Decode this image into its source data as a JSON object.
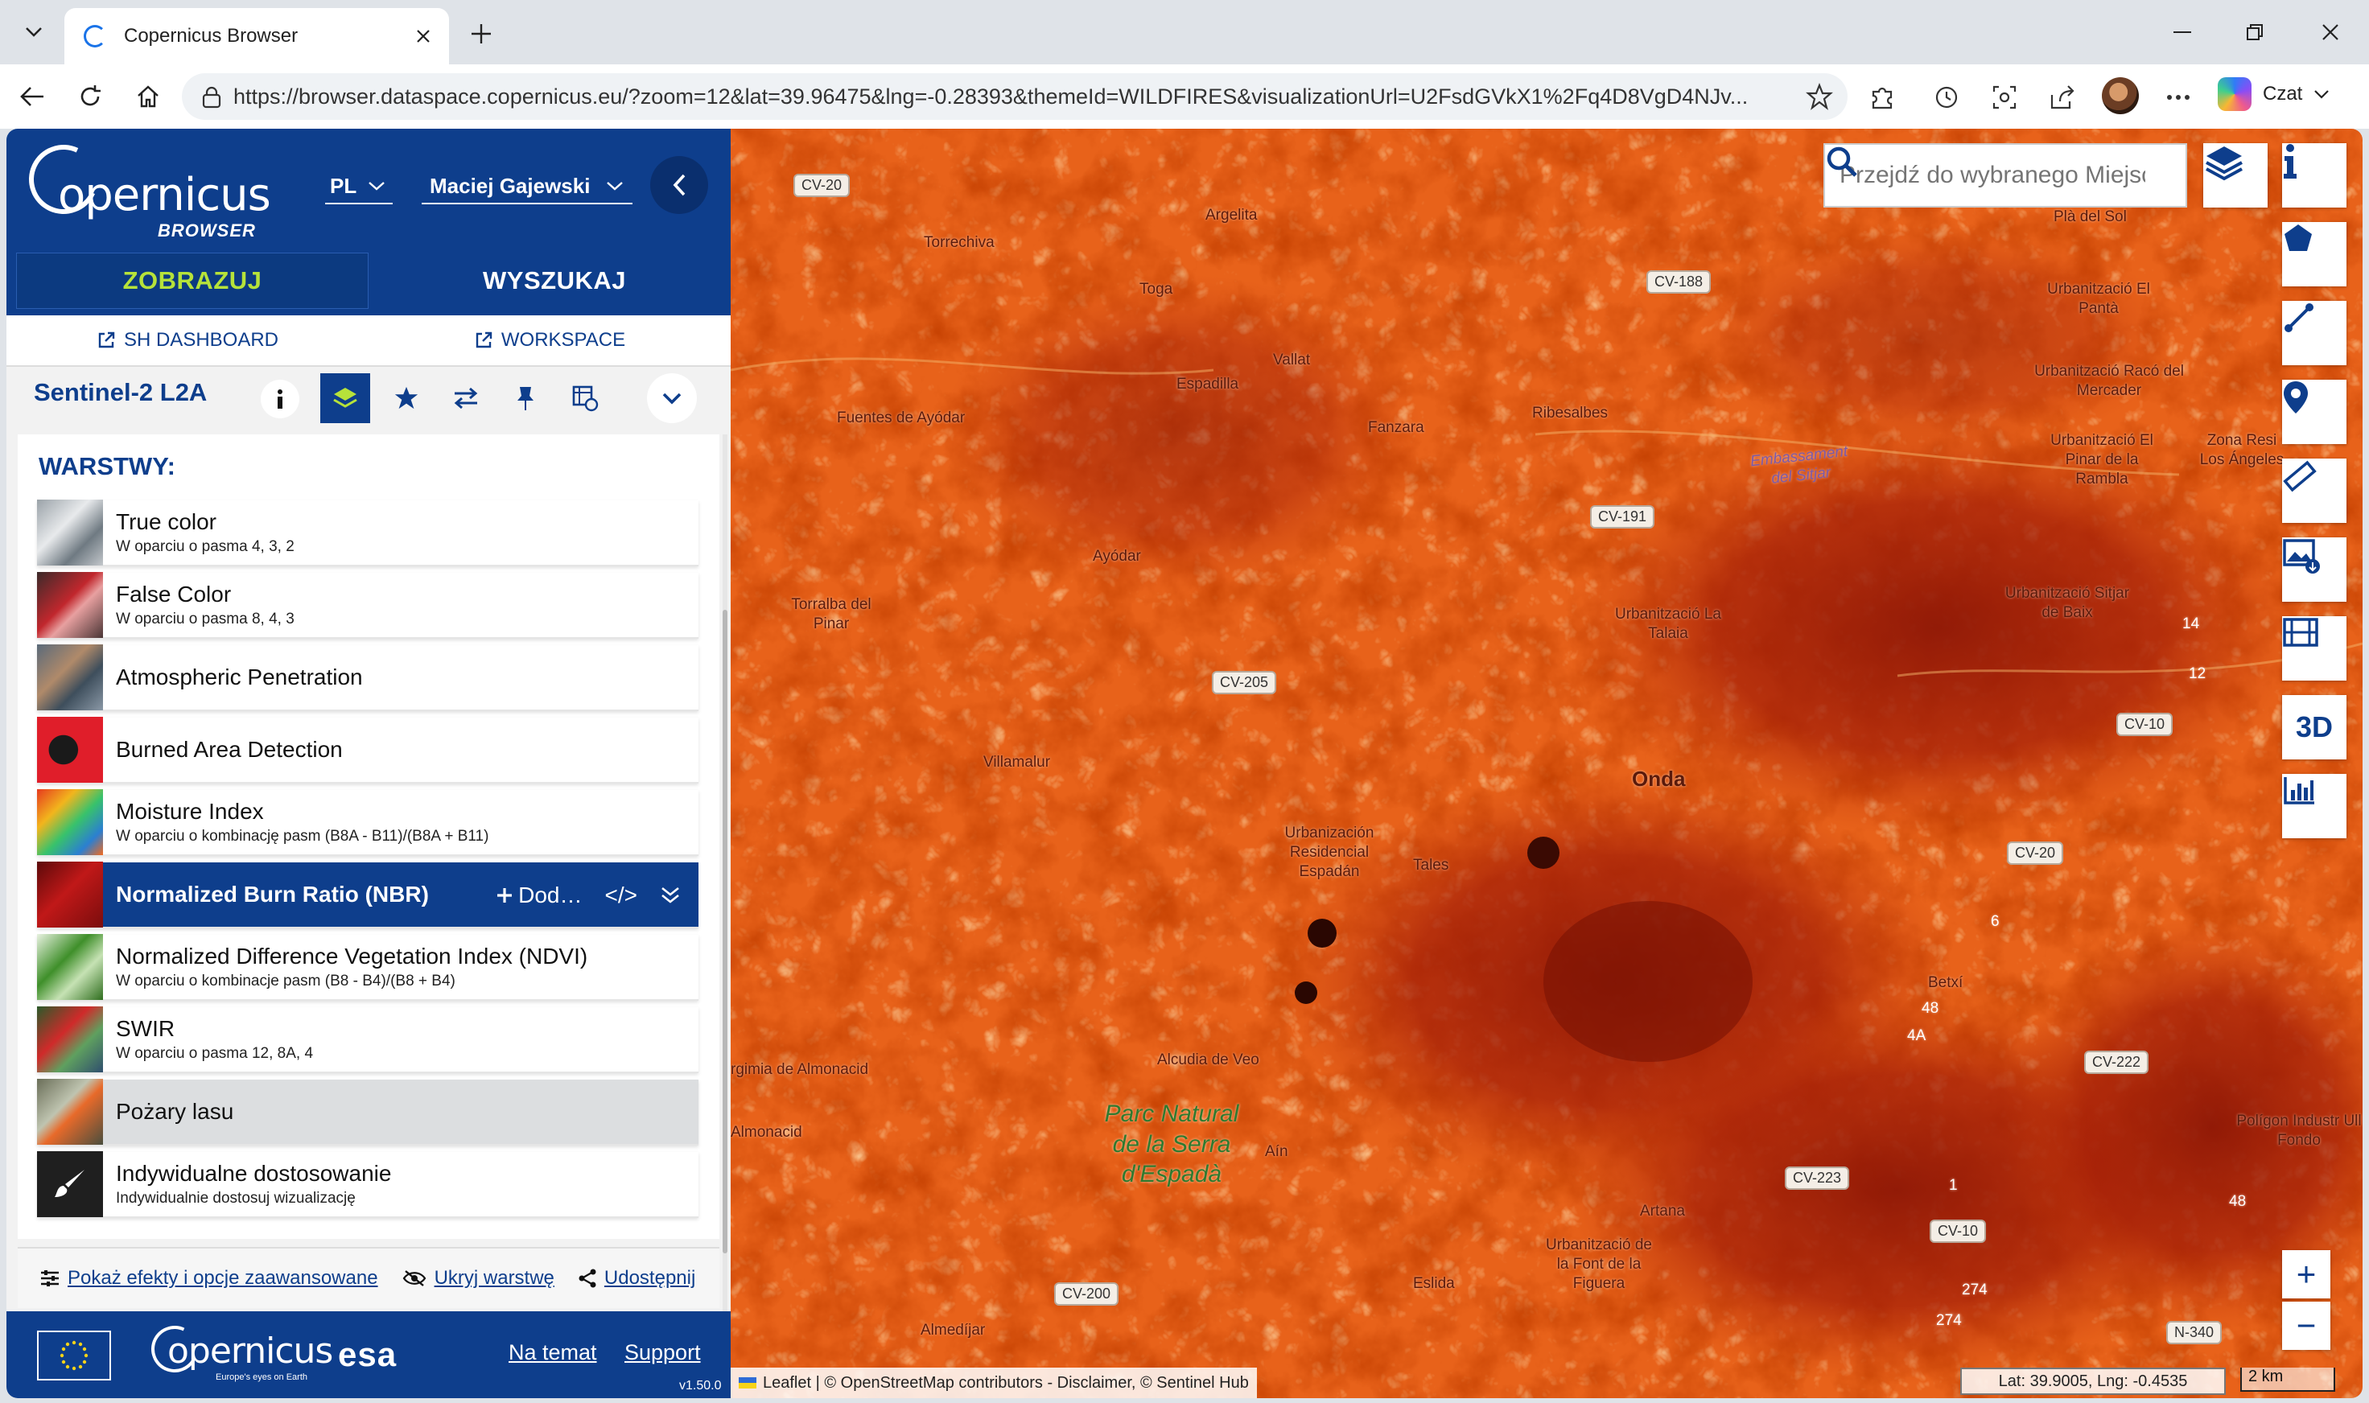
{
  "browser": {
    "tab_title": "Copernicus Browser",
    "url": "https://browser.dataspace.copernicus.eu/?zoom=12&lat=39.96475&lng=-0.28393&themeId=WILDFIRES&visualizationUrl=U2FsdGVkX1%2Fq4D8VgD4NJv...",
    "copilot_label": "Czat"
  },
  "panel": {
    "logo_word": "opernicus",
    "logo_sub": "BROWSER",
    "language": "PL",
    "user": "Maciej Gajewski",
    "tabs": [
      {
        "label": "ZOBRAZUJ",
        "active": true
      },
      {
        "label": "WYSZUKAJ",
        "active": false
      }
    ],
    "links": [
      "SH DASHBOARD",
      "WORKSPACE"
    ],
    "dataset": "Sentinel-2 L2A",
    "layers_title": "WARSTWY:",
    "layers": [
      {
        "name": "True color",
        "desc": "W oparciu o pasma 4, 3, 2"
      },
      {
        "name": "False Color",
        "desc": "W oparciu o pasma 8, 4, 3"
      },
      {
        "name": "Atmospheric Penetration",
        "desc": ""
      },
      {
        "name": "Burned Area Detection",
        "desc": ""
      },
      {
        "name": "Moisture Index",
        "desc": "W oparciu o kombinację pasm (B8A - B11)/(B8A + B11)"
      },
      {
        "name": "Normalized Burn Ratio (NBR)",
        "desc": ""
      },
      {
        "name": "Normalized Difference Vegetation Index (NDVI)",
        "desc": "W oparciu o kombinacje pasm (B8 - B4)/(B8 + B4)"
      },
      {
        "name": "SWIR",
        "desc": "W oparciu o pasma 12, 8A, 4"
      },
      {
        "name": "Pożary lasu",
        "desc": ""
      },
      {
        "name": "Indywidualne dostosowanie",
        "desc": "Indywidualnie dostosuj wizualizację"
      }
    ],
    "selected_actions": {
      "add": "Dod…",
      "code": "</>"
    },
    "bottom_links": [
      "Pokaż efekty i opcje zaawansowane",
      "Ukryj warstwę",
      "Udostępnij"
    ],
    "footer": {
      "logo_word": "opernicus",
      "logo_tag": "Europe's eyes on Earth",
      "esa": "esa",
      "about": "Na temat",
      "support": "Support",
      "version": "v1.50.0"
    }
  },
  "map": {
    "search_placeholder": "Przejdź do wybranego Miejsca",
    "attribution": "Leaflet | © OpenStreetMap contributors - Disclaimer, © Sentinel Hub",
    "coords": "Lat: 39.9005, Lng: -0.4535",
    "scale": "2 km",
    "zoom_in": "+",
    "zoom_out": "−",
    "label_3d": "3D",
    "places": [
      "Torrechiva",
      "Argelita",
      "Toga",
      "Vallat",
      "Espadilla",
      "Fuentes de Ayódar",
      "Fanzara",
      "Ribesalbes",
      "Embassament del Sitjar",
      "Ayódar",
      "Torralba del Pinar",
      "Urbanització La Talaia",
      "Villamalur",
      "Onda",
      "Urbanización Residencial Espadán",
      "Tales",
      "Betxí",
      "Alcudia de Veo",
      "Parc Natural de la Serra d'Espadà",
      "Aín",
      "Artana",
      "Urbanització de la Font de la Figuera",
      "Eslida",
      "Almedíjar",
      "Plà del Sol",
      "Urbanització El Pantà",
      "Urbanització Racó del Mercader",
      "Urbanització El Pinar de la Rambla",
      "Zona Resi Los Ángeles",
      "Urbanització Sitjar de Baix",
      "Polígon Industr Ull Fondo",
      "rgimia de Almonacid",
      "Almonacid"
    ],
    "roads": [
      "CV-20",
      "CV-188",
      "CV-191",
      "CV-205",
      "CV-10",
      "CV-20",
      "CV-222",
      "CV-223",
      "CV-10",
      "CV-200",
      "N-340"
    ],
    "route_numbers": [
      "12",
      "14",
      "6",
      "48",
      "4A",
      "1",
      "48",
      "274",
      "274"
    ]
  }
}
